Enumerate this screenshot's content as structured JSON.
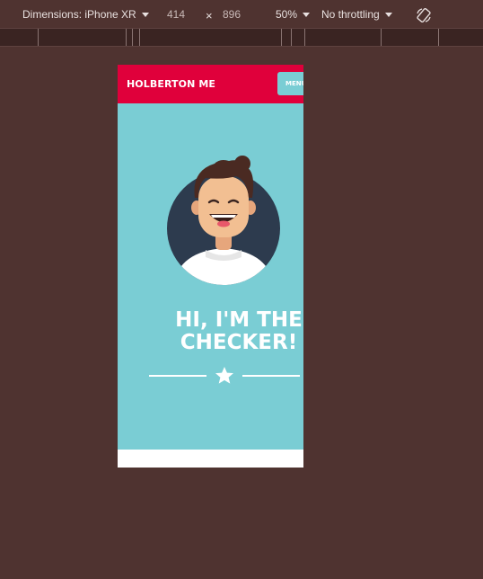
{
  "devtools": {
    "dimensions_label": "Dimensions: iPhone XR",
    "width_value": "414",
    "times": "×",
    "height_value": "896",
    "zoom": "50%",
    "throttling": "No throttling",
    "rotate_icon": "rotate-icon"
  },
  "site": {
    "brand": "HOLBERTON ME",
    "menu_label": "MENU",
    "hero_title_line1": "HI, I'M THE",
    "hero_title_line2": "CHECKER!",
    "avatar_icon": "avatar-illustration",
    "star_icon": "star-icon",
    "colors": {
      "nav": "#e0003b",
      "hero": "#7acdd4",
      "background": "#4f3330"
    }
  }
}
